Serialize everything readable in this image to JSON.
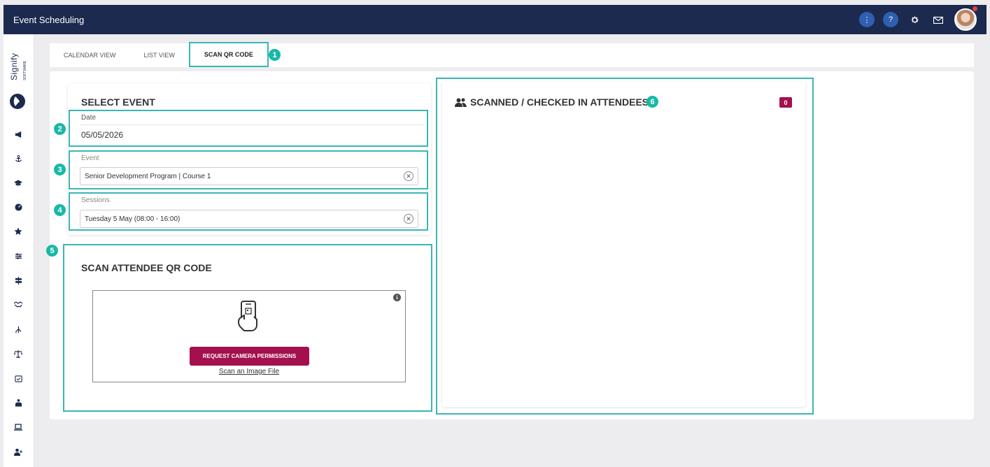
{
  "app": {
    "title": "Event Scheduling"
  },
  "header": {
    "more_label": "⋮",
    "help_label": "?",
    "brand_color": "#1c2a4f",
    "button_color": "#2f5fb0"
  },
  "logo": {
    "text": "Signify",
    "subtext": "SOFTWARE"
  },
  "sidebar": {
    "icons": [
      "megaphone-icon",
      "anchor-icon",
      "graduation-cap-icon",
      "speedometer-icon",
      "star-icon",
      "sliders-icon",
      "signpost-icon",
      "handshake-icon",
      "hierarchy-icon",
      "scales-icon",
      "calendar-check-icon",
      "user-tie-icon",
      "laptop-icon",
      "user-add-icon"
    ]
  },
  "tabs": [
    {
      "label": "CALENDAR VIEW",
      "active": false
    },
    {
      "label": "LIST VIEW",
      "active": false
    },
    {
      "label": "SCAN QR CODE",
      "active": true
    }
  ],
  "annotations": [
    "1",
    "2",
    "3",
    "4",
    "5",
    "6"
  ],
  "select_event": {
    "title": "SELECT EVENT",
    "date": {
      "label": "Date",
      "value": "05/05/2026"
    },
    "event": {
      "label": "Event",
      "value": "Senior Development Program | Course 1"
    },
    "sessions": {
      "label": "Sessions",
      "value": "Tuesday 5 May (08:00 - 16:00)"
    }
  },
  "scan": {
    "title": "SCAN ATTENDEE QR CODE",
    "camera_button": "REQUEST CAMERA PERMISSIONS",
    "scan_file_link": "Scan an Image File",
    "info_label": "i"
  },
  "attendees": {
    "title": "SCANNED / CHECKED IN ATTENDEES",
    "count": "0"
  },
  "colors": {
    "accent": "#a4104d",
    "highlight": "#3ab6b4",
    "annotation": "#19b8a8"
  }
}
